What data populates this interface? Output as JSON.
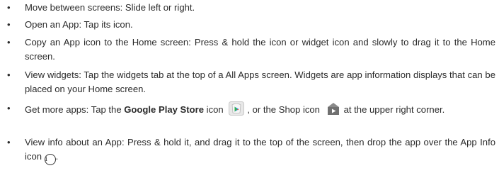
{
  "bullet_glyph": "•",
  "items": [
    {
      "text": "Move between screens: Slide left or right."
    },
    {
      "text": "Open an App: Tap its icon."
    },
    {
      "text": "Copy an App icon to the Home screen: Press & hold the icon or widget icon and slowly to drag it to the Home screen."
    },
    {
      "text": "View widgets: Tap the widgets tab at the top of a All Apps screen. Widgets are app information displays that can be placed on your Home screen."
    },
    {
      "pre": "Get more apps: Tap the ",
      "bold": "Google Play Store",
      "mid1": " icon",
      "mid2": ", or the Shop icon",
      "post": "at the upper right corner."
    },
    {
      "pre": "View info about an App: Press & hold it, and drag it to the top of the screen, then drop the app over the App Info icon ",
      "info_glyph": "i",
      "post": "."
    }
  ]
}
